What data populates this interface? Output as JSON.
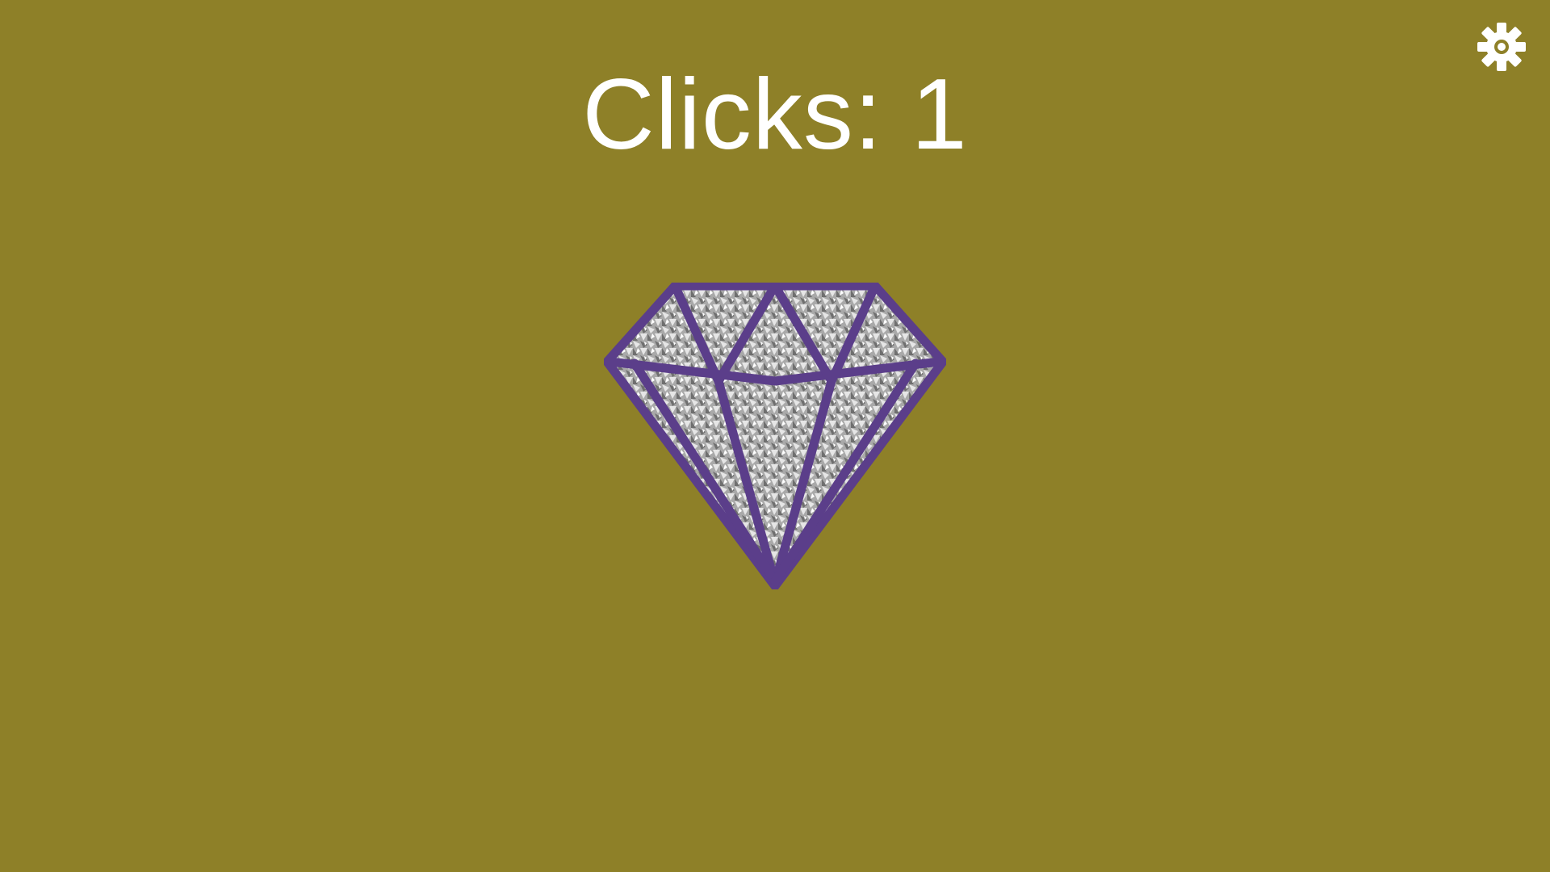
{
  "game": {
    "clicks_label": "Clicks: 1",
    "clicks": 1
  },
  "colors": {
    "background": "#8e8028",
    "text": "#ffffff",
    "diamond_outline": "#5b3e8a",
    "diamond_edge": "#1a1a1a",
    "diamond_fill_light": "#e6e6e6",
    "diamond_fill_dark": "#6f6f6f",
    "settings_icon": "#ffffff"
  },
  "icons": {
    "settings": "gear-icon",
    "clicker": "diamond-icon"
  }
}
